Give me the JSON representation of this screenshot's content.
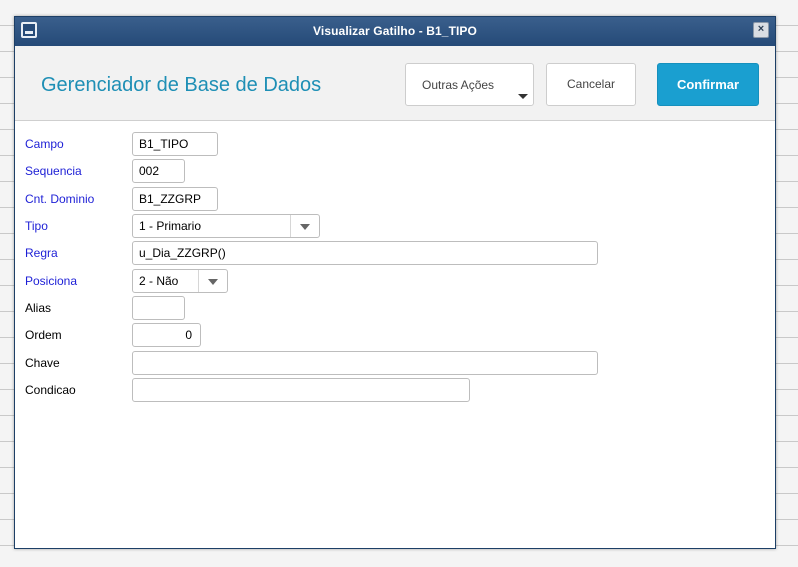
{
  "window": {
    "title": "Visualizar Gatilho - B1_TIPO",
    "close_glyph": "×"
  },
  "header": {
    "app_title": "Gerenciador de Base de Dados",
    "buttons": {
      "outras": "Outras Ações",
      "cancelar": "Cancelar",
      "confirmar": "Confirmar"
    }
  },
  "form": {
    "fields": {
      "campo": {
        "label": "Campo",
        "value": "B1_TIPO"
      },
      "sequencia": {
        "label": "Sequencia",
        "value": "002"
      },
      "cnt_dominio": {
        "label": "Cnt. Dominio",
        "value": "B1_ZZGRP"
      },
      "tipo": {
        "label": "Tipo",
        "value": "1 - Primario"
      },
      "regra": {
        "label": "Regra",
        "value": "u_Dia_ZZGRP()"
      },
      "posiciona": {
        "label": "Posiciona",
        "value": "2 - Não"
      },
      "alias": {
        "label": "Alias",
        "value": ""
      },
      "ordem": {
        "label": "Ordem",
        "value": "0"
      },
      "chave": {
        "label": "Chave",
        "value": ""
      },
      "condicao": {
        "label": "Condicao",
        "value": ""
      }
    }
  },
  "colors": {
    "accent": "#1a9fd0",
    "title_bar": "#254a78",
    "required_label": "#1d1fd6",
    "app_title": "#1e8fb5"
  },
  "icons": {
    "window": "window-icon",
    "close": "close-icon",
    "dropdown": "chevron-down-icon"
  }
}
